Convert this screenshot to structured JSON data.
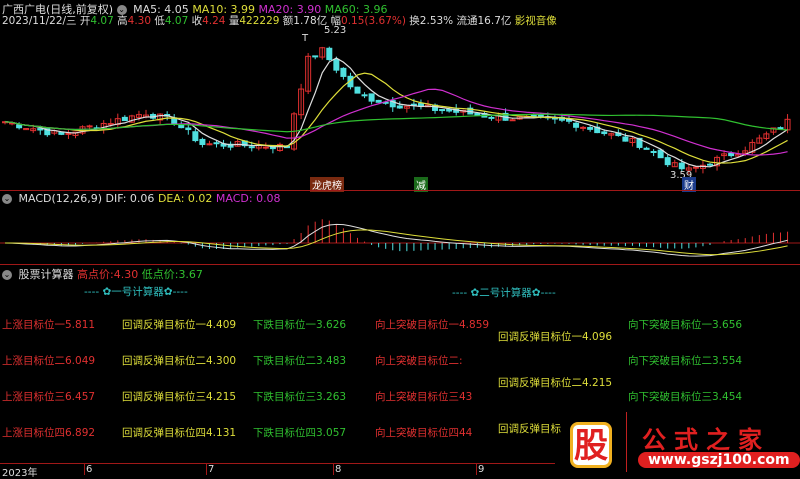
{
  "header": {
    "title": "广西广电(日线,前复权)",
    "ma5": "MA5: 4.05",
    "ma10": "MA10: 3.99",
    "ma20": "MA20: 3.90",
    "ma60": "MA60: 3.96",
    "date": "2023/11/22/三",
    "open_label": "开",
    "open": "4.07",
    "high_label": "高",
    "high": "4.30",
    "low_label": "低",
    "low": "4.07",
    "close_label": "收",
    "close": "4.24",
    "vol_label": "量",
    "vol": "422229",
    "amount": "额1.78亿",
    "change_label": "幅",
    "change": "0.15(3.67%)",
    "turnover": "换2.53%",
    "float": "流通16.7亿",
    "sector": "影视音像"
  },
  "main_chart": {
    "high_label": "5.23",
    "low_label": "3.59",
    "t_marker": "T",
    "badges": [
      "龙虎榜",
      "减",
      "财"
    ],
    "keyframes": [
      [
        0,
        4.2
      ],
      [
        8,
        4.05
      ],
      [
        10,
        4.1
      ],
      [
        20,
        4.3
      ],
      [
        24,
        4.2
      ],
      [
        28,
        3.95
      ],
      [
        40,
        3.92
      ],
      [
        41,
        4.3
      ],
      [
        43,
        4.9
      ],
      [
        45,
        5.0
      ],
      [
        47,
        4.8
      ],
      [
        50,
        4.5
      ],
      [
        55,
        4.4
      ],
      [
        60,
        4.35
      ],
      [
        70,
        4.25
      ],
      [
        80,
        4.2
      ],
      [
        90,
        3.95
      ],
      [
        95,
        3.7
      ],
      [
        97,
        3.65
      ],
      [
        105,
        3.9
      ],
      [
        111,
        4.2
      ]
    ],
    "candle_count": 112
  },
  "macd": {
    "title": "MACD(12,26,9)",
    "dif": "DIF: 0.06",
    "dea": "DEA: 0.02",
    "macd": "MACD: 0.08"
  },
  "calculator": {
    "title": "股票计算器",
    "high_label": "高点价:",
    "high": "4.30",
    "low_label": "低点价:",
    "low": "3.67",
    "group1_title": "---- ✿一号计算器✿----",
    "group2_title": "---- ✿二号计算器✿----",
    "up": [
      "上涨目标位一5.811",
      "上涨目标位二6.049",
      "上涨目标位三6.457",
      "上涨目标位四6.892"
    ],
    "rebound1": [
      "回调反弹目标位一4.409",
      "回调反弹目标位二4.300",
      "回调反弹目标位三4.215",
      "回调反弹目标位四4.131"
    ],
    "down": [
      "下跌目标位一3.626",
      "下跌目标位二3.483",
      "下跌目标位三3.263",
      "下跌目标位四3.057"
    ],
    "break_up": [
      "向上突破目标位一4.859",
      "向上突破目标位二:",
      "向上突破目标位三43",
      "向上突破目标位四44"
    ],
    "rebound2": [
      "回调反弹目标位一4.096",
      "回调反弹目标位二4.215",
      "回调反弹目标"
    ],
    "break_down": [
      "向下突破目标位一3.656",
      "向下突破目标位二3.554",
      "向下突破目标位三3.454"
    ]
  },
  "axis": {
    "year": "2023年",
    "months": [
      "6",
      "7",
      "8",
      "9"
    ]
  },
  "watermark": {
    "logo": "股",
    "name": "公式之家",
    "url": "www.gszj100.com"
  }
}
